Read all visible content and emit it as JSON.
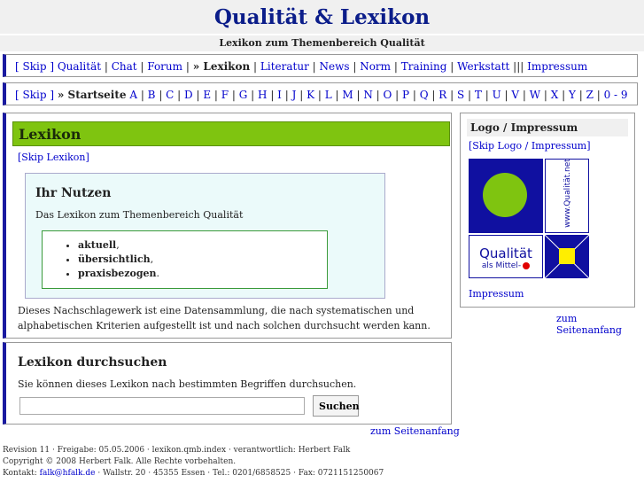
{
  "header": {
    "title": "Qualität & Lexikon",
    "subtitle": "Lexikon zum Themenbereich Qualität"
  },
  "nav1": {
    "skip": "[ Skip ]",
    "items": [
      "Qualität",
      "Chat",
      "Forum"
    ],
    "current": "» Lexikon",
    "items2": [
      "Literatur",
      "News",
      "Norm",
      "Training",
      "Werkstatt"
    ],
    "sep_triple": "|||",
    "impressum": "Impressum"
  },
  "nav2": {
    "skip": "[ Skip ]",
    "current": "» Startseite",
    "letters": [
      "A",
      "B",
      "C",
      "D",
      "E",
      "F",
      "G",
      "H",
      "I",
      "J",
      "K",
      "L",
      "M",
      "N",
      "O",
      "P",
      "Q",
      "R",
      "S",
      "T",
      "U",
      "V",
      "W",
      "X",
      "Y",
      "Z",
      "0 - 9"
    ]
  },
  "main": {
    "heading": "Lexikon",
    "skip": "[Skip Lexikon]",
    "nutzen_title": "Ihr Nutzen",
    "nutzen_desc": "Das Lexikon zum Themenbereich Qualität",
    "bullets": [
      {
        "bold": "aktuell",
        "rest": ","
      },
      {
        "bold": "übersichtlich",
        "rest": ","
      },
      {
        "bold": "praxisbezogen",
        "rest": "."
      }
    ],
    "text": "Dieses Nachschlagewerk ist eine Datensammlung, die nach systematischen und alphabetischen Kriterien aufgestellt ist und nach solchen durchsucht werden kann."
  },
  "search": {
    "title": "Lexikon durchsuchen",
    "desc": "Sie können dieses Lexikon nach bestimmten Begriffen durchsuchen.",
    "value": "",
    "button": "Suchen"
  },
  "logo": {
    "title": "Logo / Impressum",
    "skip": "[Skip Logo / Impressum]",
    "vertical_text": "www.Qualität.net",
    "word": "Qualität",
    "tagline": "als Mittel-",
    "impressum": "Impressum"
  },
  "to_top": "zum Seitenanfang",
  "footer": {
    "line1": "Revision 11 · Freigabe: 05.05.2006 · lexikon.qmb.index · verantwortlich: Herbert Falk",
    "line2": "Copyright © 2008 Herbert Falk. Alle Rechte vorbehalten.",
    "line3_prefix": "Kontakt: ",
    "email": "falk@hfalk.de",
    "line3_suffix": " · Wallstr. 20 · 45355 Essen · Tel.: 0201/6858525 · Fax: 0721151250067"
  },
  "colors": {
    "navy": "#0b1d8a",
    "green": "#7fc410",
    "logo_blue": "#1010a0",
    "logo_yellow": "#ffee00",
    "logo_red": "#e00000"
  }
}
